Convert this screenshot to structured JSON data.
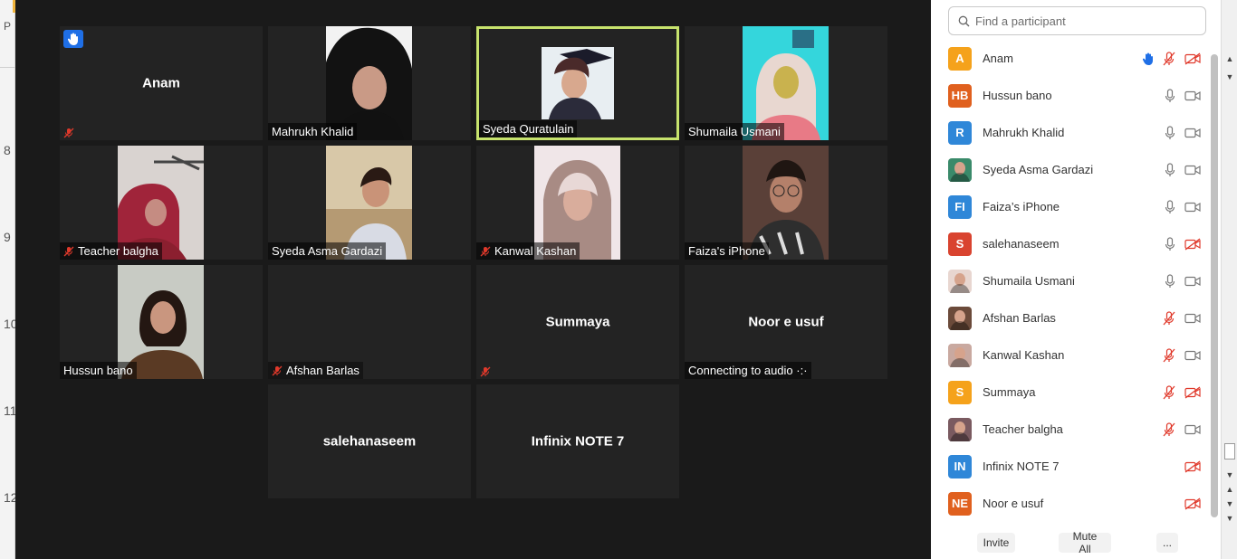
{
  "underlying_window": {
    "letter": "P",
    "line_numbers": [
      "8",
      "9",
      "10",
      "11",
      "12"
    ]
  },
  "gallery": {
    "tiles": [
      {
        "name": "Anam",
        "big_name": "Anam",
        "video": false,
        "muted": true,
        "hand_raised": true
      },
      {
        "name": "Mahrukh Khalid",
        "video": true,
        "muted": false
      },
      {
        "name": "Syeda Quratulain",
        "video": true,
        "muted": false,
        "active_speaker": true
      },
      {
        "name": "Shumaila Usmani",
        "video": true,
        "muted": false
      },
      {
        "name": "Teacher balgha",
        "video": true,
        "muted": true
      },
      {
        "name": "Syeda Asma Gardazi",
        "video": true,
        "muted": false
      },
      {
        "name": "Kanwal Kashan",
        "video": true,
        "muted": true
      },
      {
        "name": "Faiza's iPhone",
        "video": true,
        "muted": false
      },
      {
        "name": "Hussun bano",
        "video": true,
        "muted": false
      },
      {
        "name": "Afshan Barlas",
        "video": false,
        "muted": true
      },
      {
        "name": "Summaya",
        "big_name": "Summaya",
        "video": false,
        "muted": true
      },
      {
        "name": "Connecting to audio ·:·",
        "big_name": "Noor e usuf",
        "video": false,
        "muted": false
      },
      {
        "name": "",
        "big_name": "salehanaseem",
        "video": false
      },
      {
        "name": "",
        "big_name": "Infinix NOTE 7",
        "video": false
      }
    ]
  },
  "participants_panel": {
    "search_placeholder": "Find a participant",
    "participants": [
      {
        "initials": "A",
        "name": "Anam",
        "color": "#f5a21b",
        "hand": true,
        "mic": "muted",
        "video": "off"
      },
      {
        "initials": "HB",
        "name": "Hussun bano",
        "color": "#e0601e",
        "mic": "on",
        "video": "on"
      },
      {
        "initials": "R",
        "name": "Mahrukh Khalid",
        "color": "#2f87d8",
        "mic": "on",
        "video": "on"
      },
      {
        "initials": "",
        "name": "Syeda Asma Gardazi",
        "color": "#3a8a6a",
        "photo": true,
        "mic": "on",
        "video": "on"
      },
      {
        "initials": "FI",
        "name": "Faiza’s iPhone",
        "color": "#2f87d8",
        "mic": "on",
        "video": "on"
      },
      {
        "initials": "S",
        "name": "salehanaseem",
        "color": "#d9432f",
        "mic": "on",
        "video": "off"
      },
      {
        "initials": "",
        "name": "Shumaila Usmani",
        "color": "#e8d6d0",
        "photo": true,
        "mic": "on",
        "video": "on"
      },
      {
        "initials": "",
        "name": "Afshan Barlas",
        "color": "#6b4a3a",
        "photo": true,
        "mic": "muted",
        "video": "on"
      },
      {
        "initials": "",
        "name": "Kanwal Kashan",
        "color": "#c9a9a0",
        "photo": true,
        "mic": "muted",
        "video": "on"
      },
      {
        "initials": "S",
        "name": "Summaya",
        "color": "#f5a21b",
        "mic": "muted",
        "video": "off"
      },
      {
        "initials": "",
        "name": "Teacher balgha",
        "color": "#7a5a60",
        "photo": true,
        "mic": "muted",
        "video": "on"
      },
      {
        "initials": "IN",
        "name": "Infinix NOTE 7",
        "color": "#2f87d8",
        "mic": "none",
        "video": "off"
      },
      {
        "initials": "NE",
        "name": "Noor e usuf",
        "color": "#e0601e",
        "mic": "none",
        "video": "off"
      }
    ],
    "buttons": {
      "invite": "Invite",
      "mute_all": "Mute All",
      "more": "..."
    }
  },
  "colors": {
    "gallery_bg": "#1a1a1a",
    "tile_bg": "#232323",
    "active_speaker_border": "#c7e36d",
    "muted_red": "#e0392b",
    "hand_blue": "#1f6fe6"
  }
}
